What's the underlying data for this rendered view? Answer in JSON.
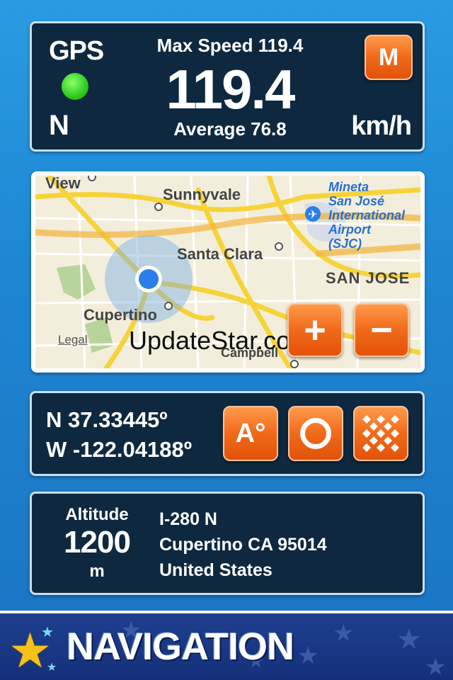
{
  "speed": {
    "gps_label": "GPS",
    "gps_status_color": "#2ecb1e",
    "heading": "N",
    "max_speed": "Max Speed 119.4",
    "current_speed": "119.4",
    "average": "Average 76.8",
    "unit": "km/h",
    "mode_button": "M"
  },
  "map": {
    "labels": {
      "view": "View",
      "sunnyvale": "Sunnyvale",
      "santa_clara": "Santa Clara",
      "san_jose": "SAN JOSE",
      "cupertino": "Cupertino",
      "campbell": "Campbell",
      "airport_line1": "Mineta",
      "airport_line2": "San José",
      "airport_line3": "International",
      "airport_line4": "Airport",
      "airport_line5": "(SJC)"
    },
    "legal": "Legal",
    "watermark": "UpdateStar.com",
    "zoom_in": "+",
    "zoom_out": "−"
  },
  "coords": {
    "latitude": "N 37.33445º",
    "longitude": "W -122.04188º",
    "altitude_button": "A°"
  },
  "location": {
    "altitude_label": "Altitude",
    "altitude_value": "1200",
    "altitude_unit": "m",
    "street": "I-280 N",
    "city": "Cupertino CA 95014",
    "country": "United States"
  },
  "banner": {
    "title": "NAVIGATION"
  }
}
